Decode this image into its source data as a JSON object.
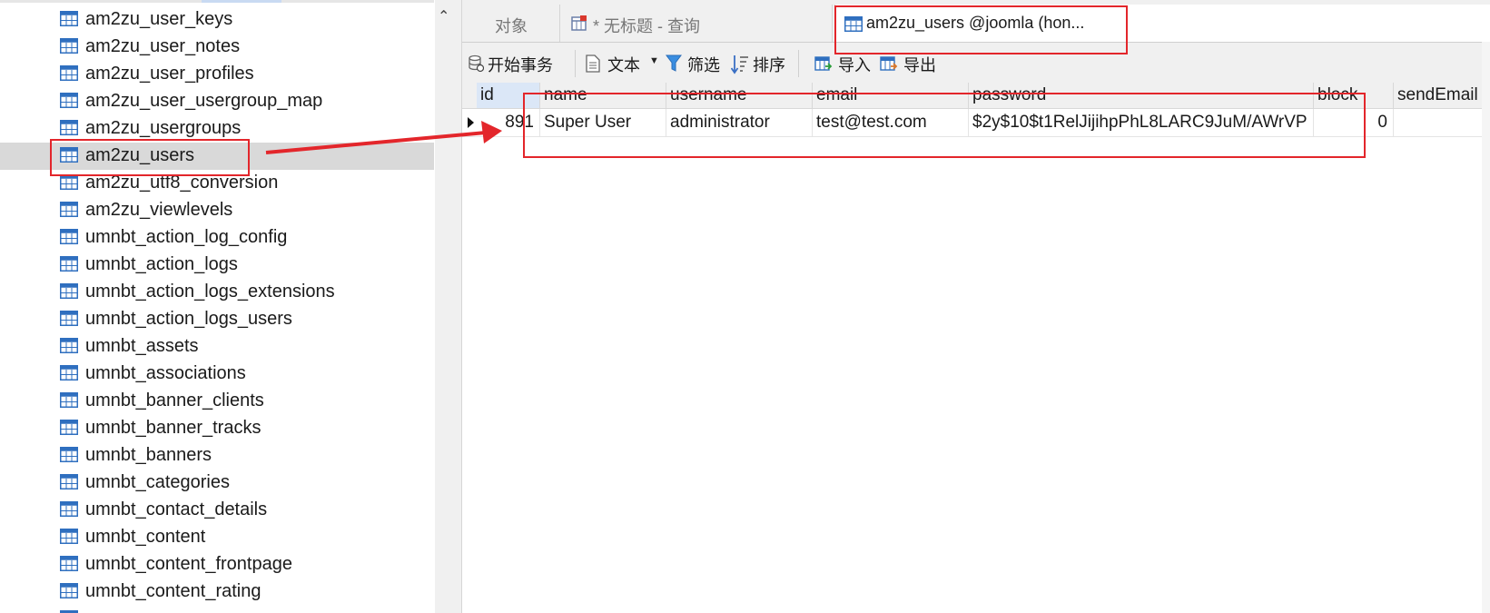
{
  "tree": {
    "items": [
      {
        "label": "am2zu_user_keys"
      },
      {
        "label": "am2zu_user_notes"
      },
      {
        "label": "am2zu_user_profiles"
      },
      {
        "label": "am2zu_user_usergroup_map"
      },
      {
        "label": "am2zu_usergroups"
      },
      {
        "label": "am2zu_users",
        "selected": true
      },
      {
        "label": "am2zu_utf8_conversion"
      },
      {
        "label": "am2zu_viewlevels"
      },
      {
        "label": "umnbt_action_log_config"
      },
      {
        "label": "umnbt_action_logs"
      },
      {
        "label": "umnbt_action_logs_extensions"
      },
      {
        "label": "umnbt_action_logs_users"
      },
      {
        "label": "umnbt_assets"
      },
      {
        "label": "umnbt_associations"
      },
      {
        "label": "umnbt_banner_clients"
      },
      {
        "label": "umnbt_banner_tracks"
      },
      {
        "label": "umnbt_banners"
      },
      {
        "label": "umnbt_categories"
      },
      {
        "label": "umnbt_contact_details"
      },
      {
        "label": "umnbt_content"
      },
      {
        "label": "umnbt_content_frontpage"
      },
      {
        "label": "umnbt_content_rating"
      },
      {
        "label": ""
      }
    ]
  },
  "tabs": {
    "objects": "对象",
    "query": "* 无标题 - 查询",
    "users": "am2zu_users @joomla (hon..."
  },
  "toolbar": {
    "begin_transaction": "开始事务",
    "text": "文本",
    "filter": "筛选",
    "sort": "排序",
    "import": "导入",
    "export": "导出"
  },
  "grid": {
    "columns": [
      "id",
      "name",
      "username",
      "email",
      "password",
      "block",
      "sendEmail"
    ],
    "rows": [
      {
        "id": "891",
        "name": "Super User",
        "username": "administrator",
        "email": "test@test.com",
        "password": "$2y$10$t1RelJijihpPhL8LARC9JuM/AWrVP",
        "block": "0",
        "sendEmail": ""
      }
    ]
  },
  "colors": {
    "annotation": "#e3262b",
    "selection": "#d9d9d9",
    "table_icon": "#2f6fbf"
  }
}
